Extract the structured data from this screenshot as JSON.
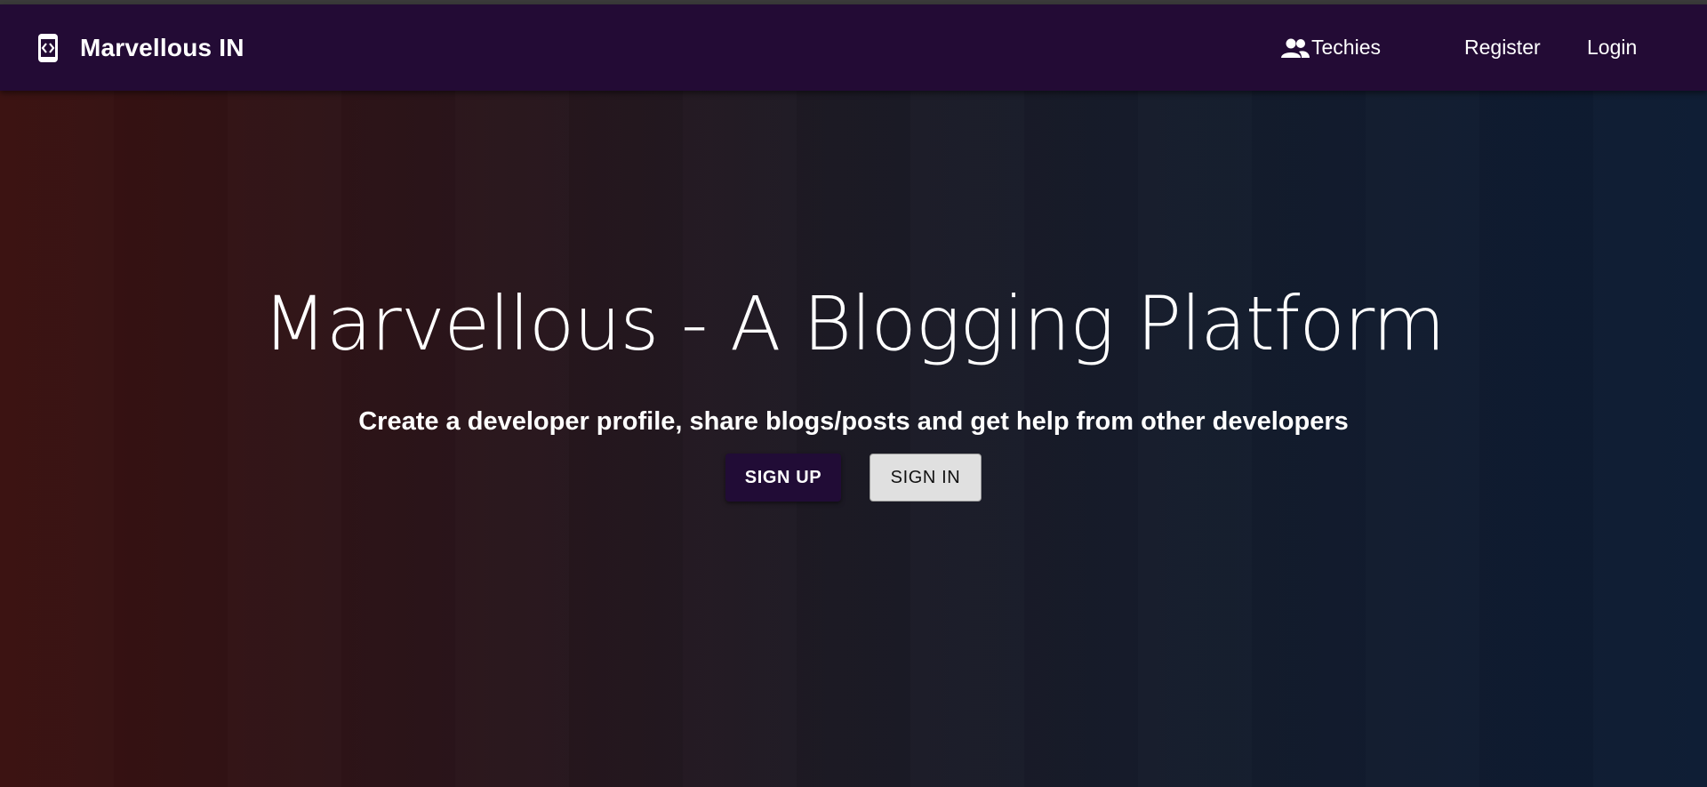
{
  "navbar": {
    "brand_icon": "code-device-icon",
    "brand_title": "Marvellous IN",
    "links": {
      "techies_icon": "people-icon",
      "techies_label": "Techies",
      "register_label": "Register",
      "login_label": "Login"
    },
    "background_color": "#230b35"
  },
  "hero": {
    "title": "Marvellous - A Blogging Platform",
    "subtitle": "Create a developer profile, share blogs/posts and get help from other developers",
    "signup_label": "SIGN UP",
    "signin_label": "SIGN IN",
    "gradient_left_color": "#3a100f",
    "gradient_right_color": "#0c1b33",
    "signup_color": "#210c36",
    "signin_color": "#e0e0e0"
  }
}
